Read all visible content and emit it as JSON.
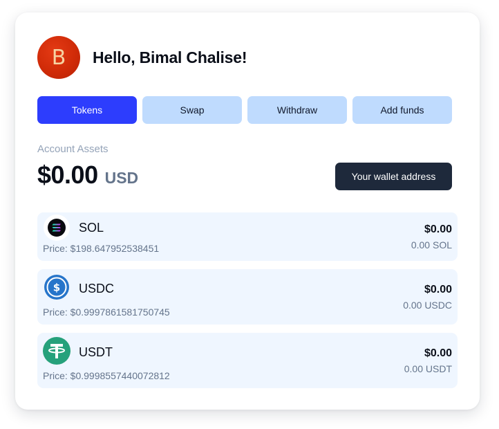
{
  "user": {
    "avatar_initial": "B",
    "greeting": "Hello, Bimal Chalise!"
  },
  "tabs": [
    {
      "label": "Tokens",
      "active": true
    },
    {
      "label": "Swap",
      "active": false
    },
    {
      "label": "Withdraw",
      "active": false
    },
    {
      "label": "Add funds",
      "active": false
    }
  ],
  "assets": {
    "label": "Account Assets",
    "total": "$0.00",
    "currency": "USD",
    "wallet_button": "Your wallet address"
  },
  "tokens": [
    {
      "symbol": "SOL",
      "icon": "sol-icon",
      "price": "Price: $198.647952538451",
      "value": "$0.00",
      "amount": "0.00 SOL"
    },
    {
      "symbol": "USDC",
      "icon": "usdc-icon",
      "price": "Price: $0.9997861581750745",
      "value": "$0.00",
      "amount": "0.00 USDC"
    },
    {
      "symbol": "USDT",
      "icon": "usdt-icon",
      "price": "Price: $0.9998557440072812",
      "value": "$0.00",
      "amount": "0.00 USDT"
    }
  ],
  "colors": {
    "primary": "#2d3dfd",
    "tab_inactive": "#bfdbfe",
    "dark_button": "#1e293b",
    "row_bg": "#eff6ff",
    "avatar": "#d02b08",
    "usdt": "#26a17b",
    "usdc": "#2775ca"
  }
}
